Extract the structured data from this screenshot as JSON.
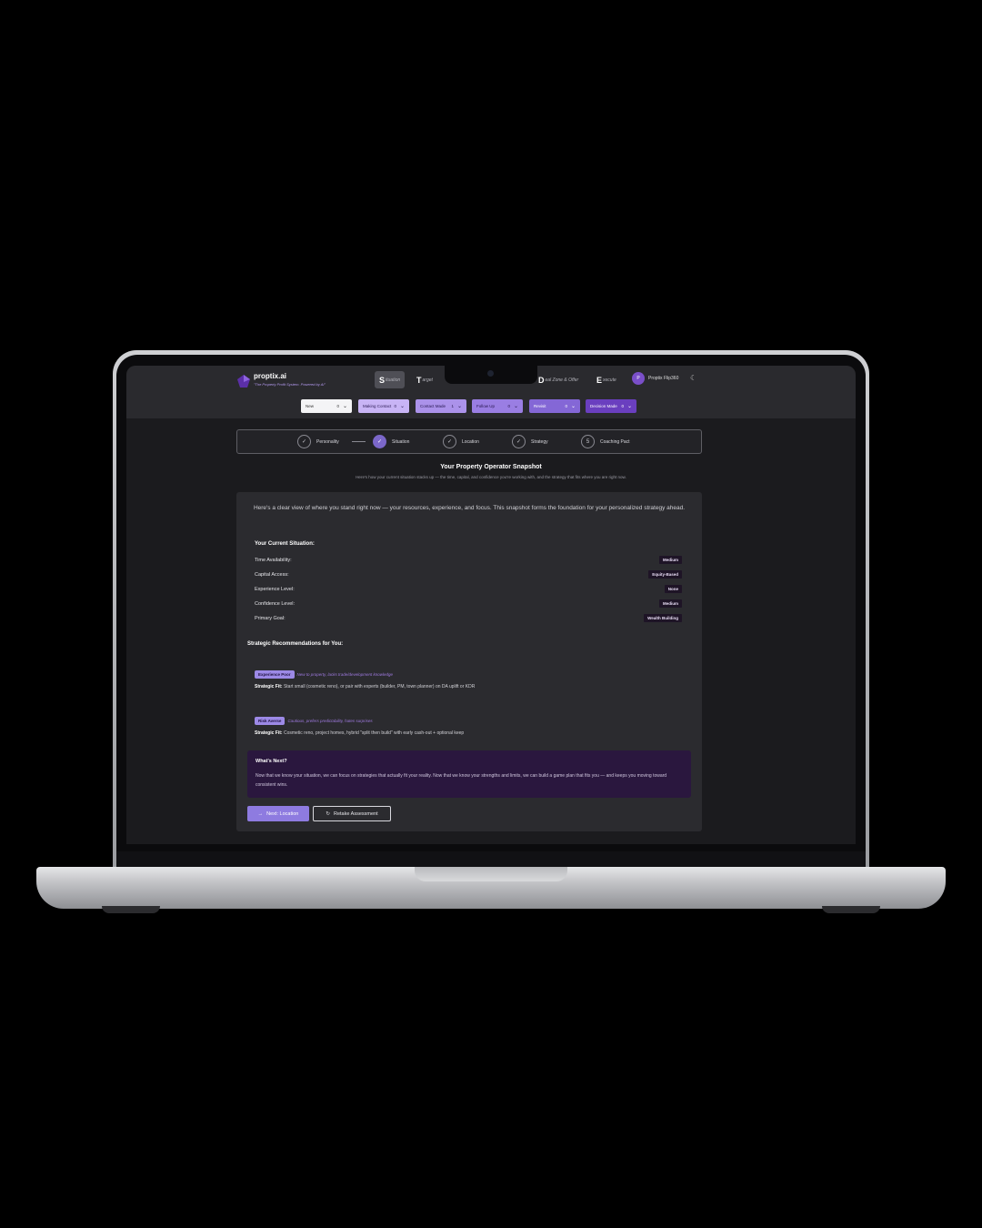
{
  "app": {
    "brand": "proptix.ai",
    "tagline": "The Property Profit System. Powered by AI"
  },
  "nav": [
    {
      "initial": "S",
      "rest": "ituation"
    },
    {
      "initial": "T",
      "rest": "arget"
    },
    {
      "initial": "D",
      "rest": "eal Zone & Offer"
    },
    {
      "initial": "E",
      "rest": "xecute"
    }
  ],
  "user": {
    "avatar": "P",
    "name": "Proptix Flip360"
  },
  "stages": [
    {
      "label": "New",
      "count": "0"
    },
    {
      "label": "Making Contact",
      "count": "0"
    },
    {
      "label": "Contact Made",
      "count": "1"
    },
    {
      "label": "Follow Up",
      "count": "0"
    },
    {
      "label": "Revisit",
      "count": "0"
    },
    {
      "label": "Decision Made",
      "count": "0"
    }
  ],
  "steps": [
    {
      "icon": "✓",
      "label": "Personality"
    },
    {
      "icon": "✓",
      "label": "Situation"
    },
    {
      "icon": "✓",
      "label": "Location"
    },
    {
      "icon": "✓",
      "label": "Strategy"
    },
    {
      "icon": "5",
      "label": "Coaching Pact"
    }
  ],
  "page": {
    "title": "Your Property Operator Snapshot",
    "subtitle": "Here's how your current situation stacks up — the time, capital, and confidence you're working with, and the strategy that fits where you are right now."
  },
  "intro": "Here's a clear view of where you stand right now — your resources, experience, and focus. This snapshot forms the foundation for your personalized strategy ahead.",
  "situation": {
    "heading": "Your Current Situation:",
    "rows": [
      {
        "label": "Time Availability:",
        "value": "Medium"
      },
      {
        "label": "Capital Access:",
        "value": "Equity-Based"
      },
      {
        "label": "Experience Level:",
        "value": "None"
      },
      {
        "label": "Confidence Level:",
        "value": "Medium"
      },
      {
        "label": "Primary Goal:",
        "value": "Wealth Building"
      }
    ]
  },
  "recommendations": {
    "heading": "Strategic Recommendations for You:",
    "items": [
      {
        "tag": "Experience Poor",
        "desc": "New to property, lacks trade/development knowledge",
        "fit_label": "Strategic Fit:",
        "fit": "Start small (cosmetic reno), or pair with experts (builder, PM, town planner) on DA uplift or KDR"
      },
      {
        "tag": "Risk Averse",
        "desc": "Cautious, prefers predictability, hates surprises",
        "fit_label": "Strategic Fit:",
        "fit": "Cosmetic reno, project homes, hybrid \"split then build\" with early cash-out + optional keep"
      }
    ]
  },
  "next": {
    "title": "What's Next?",
    "body": "Now that we know your situation, we can focus on strategies that actually fit your reality. Now that we know your strengths and limits, we can build a game plan that fits you — and keeps you moving toward consistent wins."
  },
  "buttons": {
    "next": "Next: Location",
    "retake": "Retake Assessment"
  },
  "colors": {
    "accent": "#8e7be0",
    "background": "#1b1b1e",
    "card": "#2b2b2f"
  }
}
